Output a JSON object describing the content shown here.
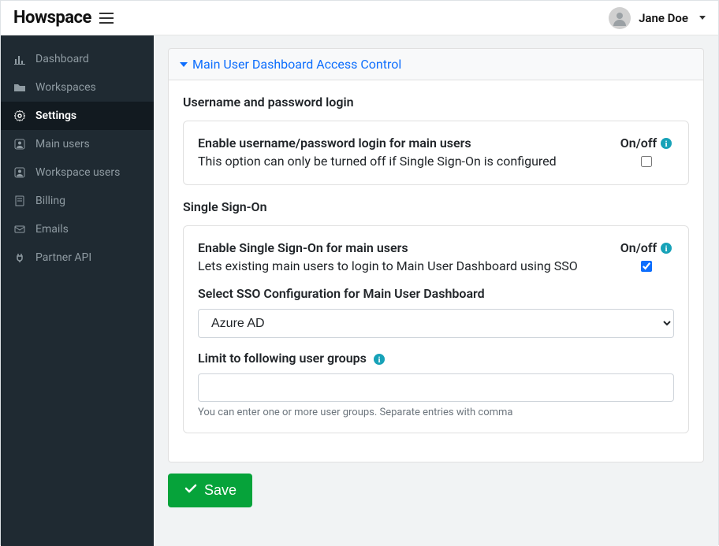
{
  "header": {
    "logo": "Howspace",
    "user_name": "Jane Doe"
  },
  "sidebar": {
    "items": [
      {
        "label": "Dashboard"
      },
      {
        "label": "Workspaces"
      },
      {
        "label": "Settings",
        "active": true
      },
      {
        "label": "Main users"
      },
      {
        "label": "Workspace users"
      },
      {
        "label": "Billing"
      },
      {
        "label": "Emails"
      },
      {
        "label": "Partner API"
      }
    ]
  },
  "panel": {
    "title": "Main User Dashboard Access Control",
    "username_section_title": "Username and password login",
    "username_card": {
      "label": "Enable username/password login for main users",
      "desc": "This option can only be turned off if Single Sign-On is configured",
      "onoff": "On/off",
      "checked": false
    },
    "sso_section_title": "Single Sign-On",
    "sso_card": {
      "enable_label": "Enable Single Sign-On for main users",
      "enable_desc": "Lets existing main users to login to Main User Dashboard using SSO",
      "enable_onoff": "On/off",
      "enable_checked": true,
      "select_label": "Select SSO Configuration for Main User Dashboard",
      "select_value": "Azure AD",
      "limit_label": "Limit to following user groups",
      "limit_value": "",
      "limit_help": "You can enter one or more user groups. Separate entries with comma"
    },
    "save_label": "Save"
  }
}
